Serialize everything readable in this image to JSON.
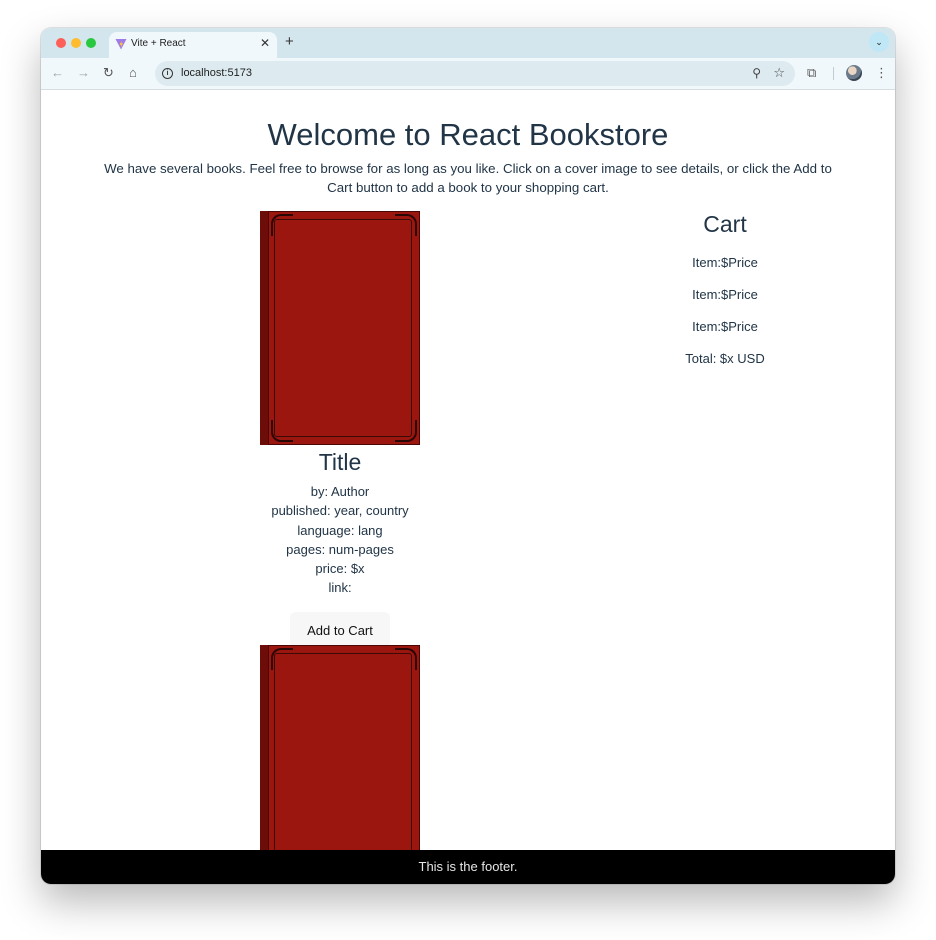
{
  "browser": {
    "tab_title": "Vite + React",
    "tab_close": "✕",
    "new_tab": "+",
    "tab_search": "⌄",
    "url": "localhost:5173",
    "info_glyph": "i",
    "zoom_glyph": "⚲",
    "star_glyph": "☆",
    "back_glyph": "←",
    "forward_glyph": "→",
    "reload_glyph": "↻",
    "home_glyph": "⌂",
    "extensions_glyph": "⧉",
    "menu_glyph": "⋮",
    "icons": [
      "back-icon",
      "forward-icon",
      "reload-icon",
      "home-icon",
      "info-icon",
      "zoom-icon",
      "star-icon",
      "extensions-icon",
      "profile-avatar",
      "menu-icon"
    ]
  },
  "header": {
    "title": "Welcome to React Bookstore",
    "intro": "We have several books. Feel free to browse for as long as you like. Click on a cover image to see details, or click the Add to Cart button to add a book to your shopping cart."
  },
  "books": [
    {
      "title": "Title",
      "author": "by: Author",
      "published": "published: year, country",
      "language": "language: lang",
      "pages": "pages: num-pages",
      "price": "price: $x",
      "link": "link:",
      "button_label": "Add to Cart",
      "cover_color": "#9c1610"
    },
    {
      "cover_color": "#9c1610"
    }
  ],
  "cart": {
    "title": "Cart",
    "items": [
      "Item:$Price",
      "Item:$Price",
      "Item:$Price"
    ],
    "total": "Total: $x USD"
  },
  "footer": {
    "text": "This is the footer."
  }
}
